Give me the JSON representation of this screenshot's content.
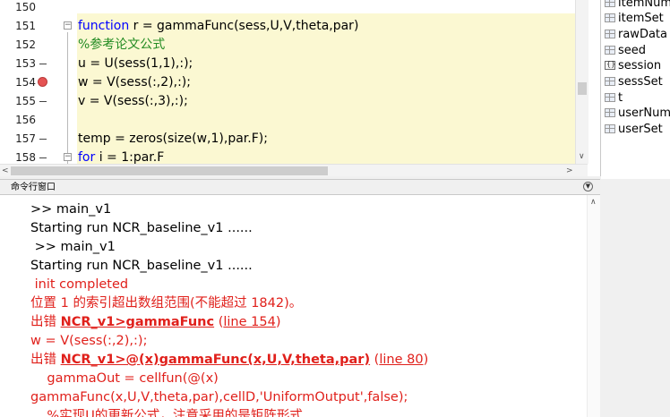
{
  "editor": {
    "lines": [
      {
        "num": "150",
        "code": ""
      },
      {
        "num": "151",
        "code_kw": "function",
        "code_rest": " r = gammaFunc(sess,U,V,theta,par)"
      },
      {
        "num": "152",
        "comment": "%参考论文公式"
      },
      {
        "num": "153",
        "code": "u = U(sess(1,1),:);"
      },
      {
        "num": "154",
        "code": "w = V(sess(:,2),:);",
        "breakpoint": true
      },
      {
        "num": "155",
        "code": "v = V(sess(:,3),:);"
      },
      {
        "num": "156",
        "code": ""
      },
      {
        "num": "157",
        "code": "temp = zeros(size(w,1),par.F);"
      },
      {
        "num": "158",
        "code_kw": "for",
        "code_rest": " i = 1:par.F"
      }
    ]
  },
  "workspace": {
    "items": [
      {
        "name": "itemNum",
        "icon": "matrix-icon"
      },
      {
        "name": "itemSet",
        "icon": "matrix-icon"
      },
      {
        "name": "rawData",
        "icon": "matrix-icon"
      },
      {
        "name": "seed",
        "icon": "matrix-icon"
      },
      {
        "name": "session",
        "icon": "object-icon"
      },
      {
        "name": "sessSet",
        "icon": "matrix-icon"
      },
      {
        "name": "t",
        "icon": "matrix-icon"
      },
      {
        "name": "userNum",
        "icon": "matrix-icon"
      },
      {
        "name": "userSet",
        "icon": "matrix-icon"
      }
    ]
  },
  "command_window": {
    "title": "命令行窗口",
    "lines": {
      "l0": ">> main_v1",
      "l1": "Starting run NCR_baseline_v1 ......",
      "l2": " >> main_v1",
      "l3": "Starting run NCR_baseline_v1 ......",
      "l4": " init completed",
      "l5": "位置 1 的索引超出数组范围(不能超过 1842)。",
      "l6_prefix": "出错 ",
      "l6_link": "NCR_v1>gammaFunc",
      "l6_open": " (",
      "l6_line": "line 154",
      "l6_close": ")",
      "l7": "w = V(sess(:,2),:);",
      "l8_prefix": "出错 ",
      "l8_link": "NCR_v1>@(x)gammaFunc(x,U,V,theta,par)",
      "l8_open": " (",
      "l8_line": "line 80",
      "l8_close": ")",
      "l9": "    gammaOut = cellfun(@(x)",
      "l10": "gammaFunc(x,U,V,theta,par),cellD,'UniformOutput',false);",
      "l11": "    %实现U的更新公式，注意采用的是矩阵形式"
    }
  },
  "colors": {
    "error": "#e0201b",
    "keyword": "#0000ff",
    "comment": "#228b22",
    "highlight": "#fbf8d2",
    "breakpoint": "#e55353"
  }
}
